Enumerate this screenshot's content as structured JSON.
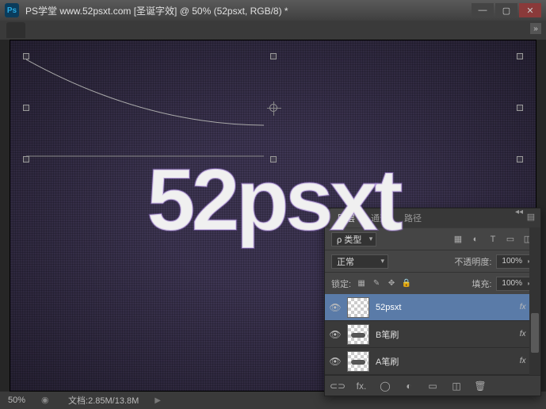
{
  "titlebar": {
    "app_icon_text": "Ps",
    "title": "PS学堂  www.52psxt.com [圣诞字效] @ 50% (52psxt, RGB/8) *"
  },
  "window_buttons": {
    "min": "—",
    "max": "▢",
    "close": "✕"
  },
  "document_tab": {
    "label": ""
  },
  "canvas": {
    "text_effect": "52psxt"
  },
  "statusbar": {
    "zoom": "50%",
    "doc_info": "文档:2.85M/13.8M",
    "arrow": "▶"
  },
  "panel": {
    "tabs": {
      "layers": "图层",
      "channels": "通道",
      "paths": "路径"
    },
    "collapse": "◂◂",
    "menu": "▤",
    "kind_label": "ρ 类型",
    "kind_value": "",
    "filter_icons": {
      "image": "▦",
      "adjust": "◐",
      "text": "T",
      "shape": "▭",
      "smart": "◫"
    },
    "blend_mode": "正常",
    "opacity_label": "不透明度:",
    "opacity_value": "100%",
    "lock_label": "锁定:",
    "lock_icons": {
      "trans": "▦",
      "brush": "✎",
      "move": "✥",
      "all": "🔒"
    },
    "fill_label": "填充:",
    "fill_value": "100%",
    "layers": [
      {
        "name": "52psxt",
        "fx": "fx"
      },
      {
        "name": "B笔刷",
        "fx": "fx"
      },
      {
        "name": "A笔刷",
        "fx": "fx"
      }
    ],
    "footer": {
      "link": "⊂⊃",
      "fx": "fx.",
      "mask": "◯",
      "adjust": "◐",
      "group": "▭",
      "new": "◫",
      "trash": "🗑"
    }
  }
}
